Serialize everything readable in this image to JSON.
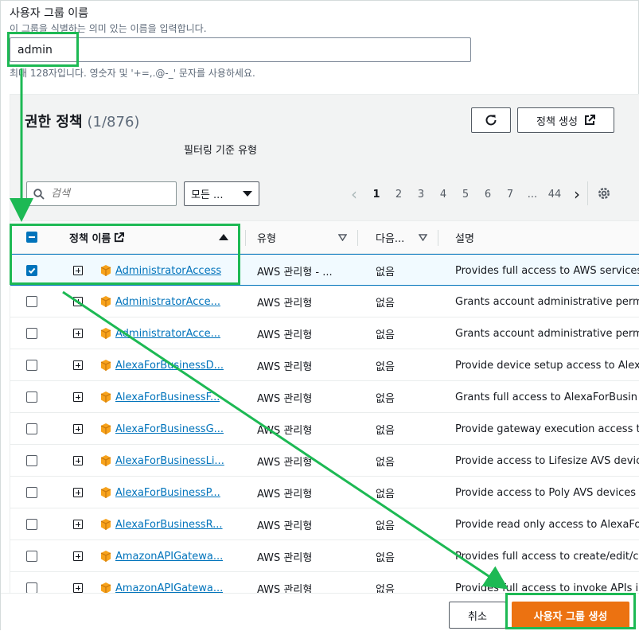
{
  "form": {
    "group_name_label": "사용자 그룹 이름",
    "group_name_desc": "이 그룹을 식별하는 의미 있는 이름을 입력합니다.",
    "group_name_value": "admin",
    "group_name_constraint": "최대 128자입니다. 영숫자 및 '+=,.@-_' 문자를 사용하세요."
  },
  "policies": {
    "title": "권한 정책",
    "count": "(1/876)",
    "create_policy_label": "정책 생성",
    "filter_label": "필터링 기준 유형",
    "search_placeholder": "검색",
    "type_select_value": "모든 ...",
    "pagination": {
      "pages": [
        "1",
        "2",
        "3",
        "4",
        "5",
        "6",
        "7",
        "...",
        "44"
      ],
      "current": "1"
    },
    "columns": {
      "name": "정책 이름",
      "type": "유형",
      "used_as": "다음...",
      "description": "설명"
    },
    "rows": [
      {
        "name": "AdministratorAccess",
        "type": "AWS 관리형 - ...",
        "used": "없음",
        "desc": "Provides full access to AWS services",
        "checked": true
      },
      {
        "name": "AdministratorAcce...",
        "type": "AWS 관리형",
        "used": "없음",
        "desc": "Grants account administrative perm",
        "checked": false
      },
      {
        "name": "AdministratorAcce...",
        "type": "AWS 관리형",
        "used": "없음",
        "desc": "Grants account administrative perm",
        "checked": false
      },
      {
        "name": "AlexaForBusinessD...",
        "type": "AWS 관리형",
        "used": "없음",
        "desc": "Provide device setup access to Alex",
        "checked": false
      },
      {
        "name": "AlexaForBusinessF...",
        "type": "AWS 관리형",
        "used": "없음",
        "desc": "Grants full access to AlexaForBusin",
        "checked": false
      },
      {
        "name": "AlexaForBusinessG...",
        "type": "AWS 관리형",
        "used": "없음",
        "desc": "Provide gateway execution access t",
        "checked": false
      },
      {
        "name": "AlexaForBusinessLi...",
        "type": "AWS 관리형",
        "used": "없음",
        "desc": "Provide access to Lifesize AVS devic",
        "checked": false
      },
      {
        "name": "AlexaForBusinessP...",
        "type": "AWS 관리형",
        "used": "없음",
        "desc": "Provide access to Poly AVS devices",
        "checked": false
      },
      {
        "name": "AlexaForBusinessR...",
        "type": "AWS 관리형",
        "used": "없음",
        "desc": "Provide read only access to AlexaFo",
        "checked": false
      },
      {
        "name": "AmazonAPIGatewa...",
        "type": "AWS 관리형",
        "used": "없음",
        "desc": "Provides full access to create/edit/c",
        "checked": false
      },
      {
        "name": "AmazonAPIGatewa...",
        "type": "AWS 관리형",
        "used": "없음",
        "desc": "Provides full access to invoke APIs i",
        "checked": false
      }
    ]
  },
  "footer": {
    "cancel_label": "취소",
    "create_group_label": "사용자 그룹 생성"
  },
  "colors": {
    "link": "#0073bb",
    "primary": "#ec7211",
    "annotation": "#1db954",
    "aws_box": "#f7a21b"
  }
}
